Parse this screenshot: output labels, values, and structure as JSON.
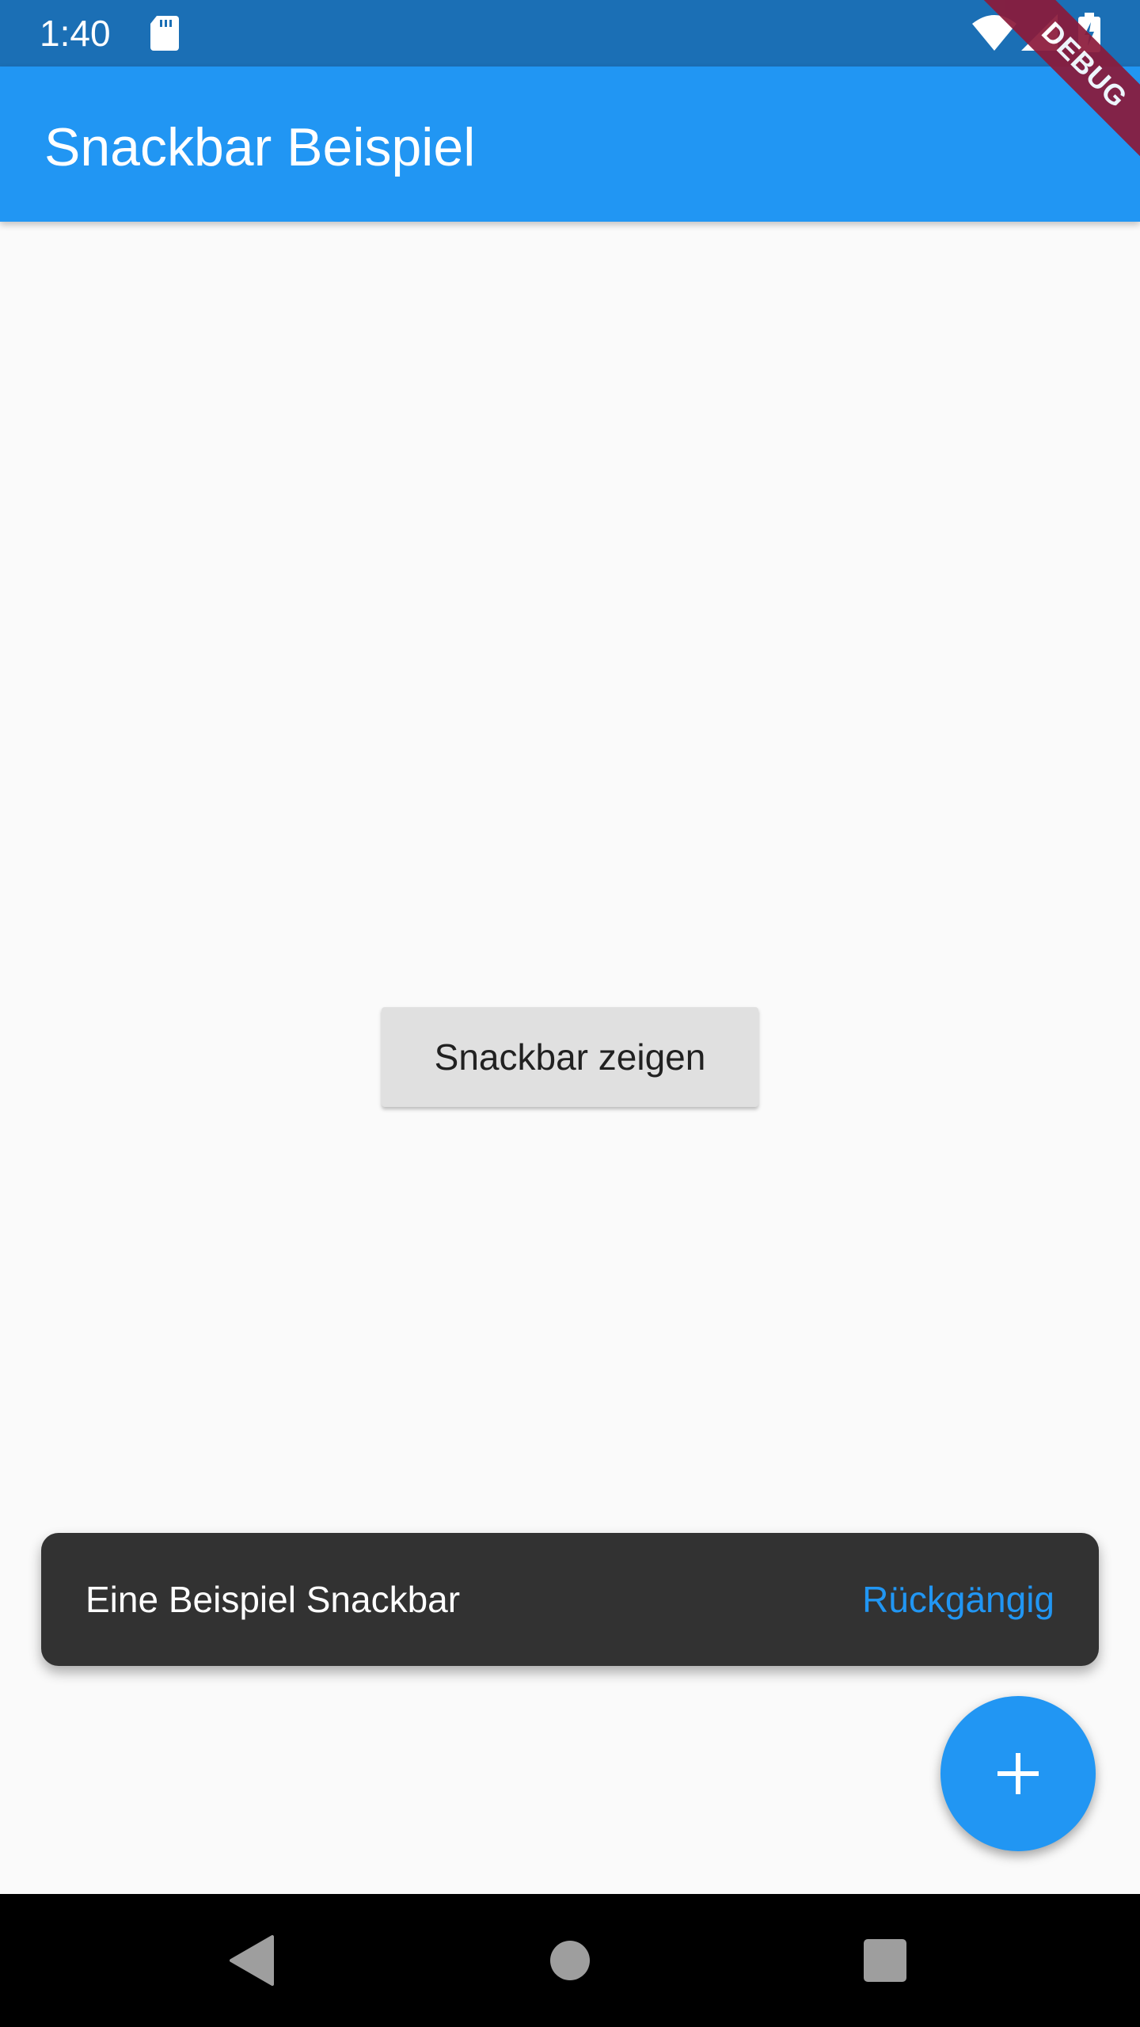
{
  "status_bar": {
    "time": "1:40",
    "icons": [
      "sd-card-icon",
      "wifi-icon",
      "cell-signal-icon",
      "battery-charging-icon"
    ]
  },
  "app_bar": {
    "title": "Snackbar Beispiel",
    "background": "#2196f3"
  },
  "debug_banner": {
    "label": "DEBUG"
  },
  "main": {
    "button_label": "Snackbar zeigen"
  },
  "snackbar": {
    "message": "Eine Beispiel Snackbar",
    "action_label": "Rückgängig",
    "action_color": "#2196f3",
    "background": "#323232"
  },
  "fab": {
    "icon": "plus-icon",
    "color": "#2196f3"
  },
  "nav_bar": {
    "icons": [
      "back-icon",
      "home-icon",
      "recents-icon"
    ]
  },
  "colors": {
    "status_bar": "#1b6fb5",
    "accent": "#2196f3",
    "page_background": "#fafafa"
  }
}
